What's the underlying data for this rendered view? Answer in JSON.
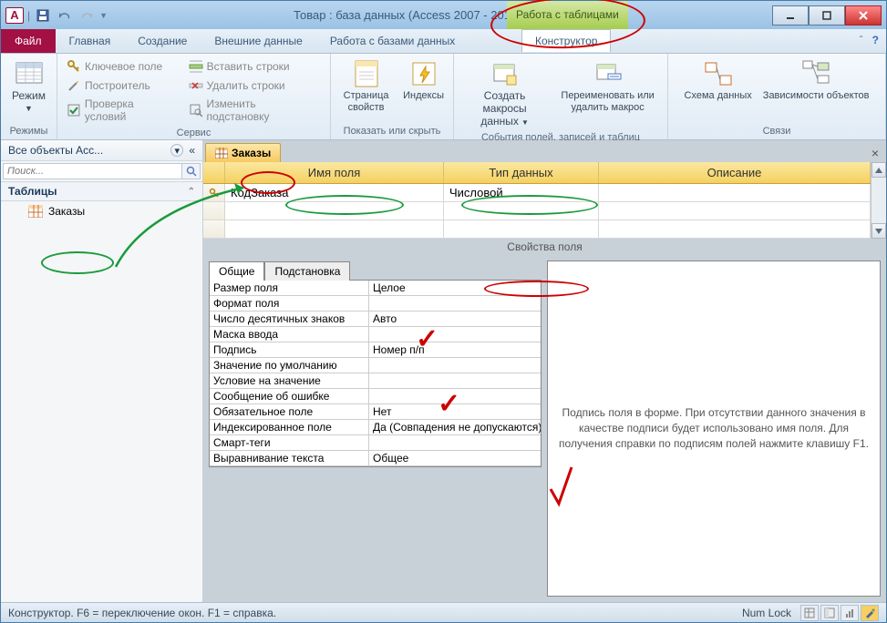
{
  "title": "Товар : база данных (Access 2007 - 2010) - Microsof...",
  "context_tab_header": "Работа с таблицами",
  "tabs": {
    "file": "Файл",
    "home": "Главная",
    "create": "Создание",
    "external": "Внешние данные",
    "dbtools": "Работа с базами данных",
    "ctx": "Конструктор"
  },
  "ribbon": {
    "modes": {
      "label": "Режимы",
      "view": "Режим"
    },
    "service": {
      "label": "Сервис",
      "primary_key": "Ключевое поле",
      "builder": "Построитель",
      "test_rules": "Проверка условий",
      "insert_rows": "Вставить строки",
      "delete_rows": "Удалить строки",
      "modify_lookup": "Изменить подстановку"
    },
    "show_hide": {
      "label": "Показать или скрыть",
      "property_sheet": "Страница свойств",
      "indexes": "Индексы"
    },
    "events": {
      "label": "События полей, записей и таблиц",
      "create_macros": "Создать макросы данных",
      "rename_delete": "Переименовать или удалить макрос"
    },
    "relations": {
      "label": "Связи",
      "schema": "Схема данных",
      "deps": "Зависимости объектов"
    }
  },
  "nav": {
    "title": "Все объекты Acc...",
    "search_placeholder": "Поиск...",
    "tables_header": "Таблицы",
    "items": [
      {
        "name": "Заказы"
      }
    ]
  },
  "doc": {
    "tab_label": "Заказы",
    "columns": {
      "field_name": "Имя поля",
      "data_type": "Тип данных",
      "description": "Описание"
    },
    "rows": [
      {
        "field": "КодЗаказа",
        "type": "Числовой",
        "desc": ""
      }
    ]
  },
  "properties": {
    "section_title": "Свойства поля",
    "tabs": {
      "general": "Общие",
      "lookup": "Подстановка"
    },
    "rows": [
      {
        "label": "Размер поля",
        "value": "Целое"
      },
      {
        "label": "Формат поля",
        "value": ""
      },
      {
        "label": "Число десятичных знаков",
        "value": "Авто"
      },
      {
        "label": "Маска ввода",
        "value": ""
      },
      {
        "label": "Подпись",
        "value": "Номер п/п"
      },
      {
        "label": "Значение по умолчанию",
        "value": ""
      },
      {
        "label": "Условие на значение",
        "value": ""
      },
      {
        "label": "Сообщение об ошибке",
        "value": ""
      },
      {
        "label": "Обязательное поле",
        "value": "Нет"
      },
      {
        "label": "Индексированное поле",
        "value": "Да (Совпадения не допускаются)"
      },
      {
        "label": "Смарт-теги",
        "value": ""
      },
      {
        "label": "Выравнивание текста",
        "value": "Общее"
      }
    ],
    "help_text": "Подпись поля в форме. При отсутствии данного значения в качестве подписи будет использовано имя поля. Для получения справки по подписям полей нажмите клавишу F1."
  },
  "status": {
    "left": "Конструктор.  F6 = переключение окон.  F1 = справка.",
    "numlock": "Num Lock"
  }
}
